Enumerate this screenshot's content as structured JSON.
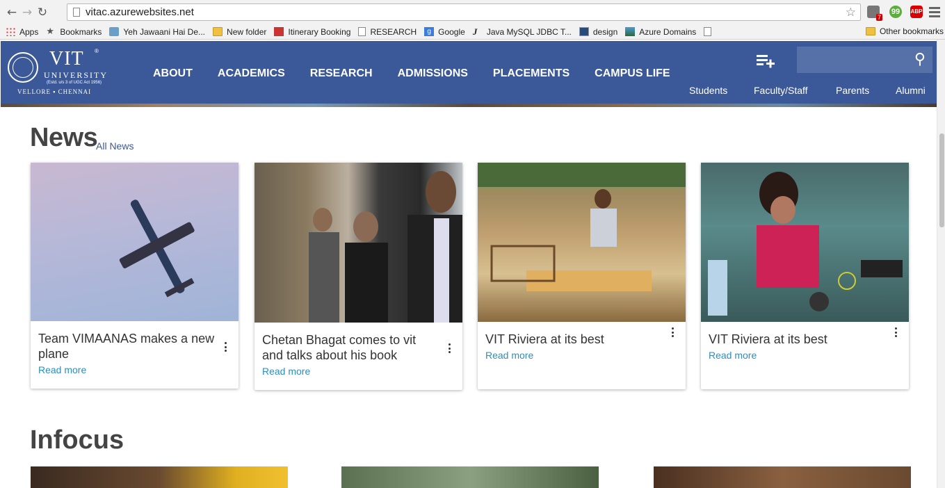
{
  "browser": {
    "url": "vitac.azurewebsites.net",
    "ext_badge": "7",
    "ext_abp": "ABP",
    "ext_green": "99"
  },
  "bookmarks": {
    "items": [
      {
        "label": "Apps",
        "icon": "apps-grid-icon"
      },
      {
        "label": "Bookmarks",
        "icon": "star-icon"
      },
      {
        "label": "Yeh Jawaani Hai De...",
        "icon": "page-icon"
      },
      {
        "label": "New folder",
        "icon": "folder-icon"
      },
      {
        "label": "Itinerary Booking",
        "icon": "page-icon"
      },
      {
        "label": "RESEARCH",
        "icon": "document-icon"
      },
      {
        "label": "Google",
        "icon": "google-icon"
      },
      {
        "label": "Java MySQL JDBC T...",
        "icon": "page-icon"
      },
      {
        "label": "design",
        "icon": "page-icon"
      },
      {
        "label": "Azure Domains",
        "icon": "page-icon"
      }
    ],
    "other": "Other bookmarks"
  },
  "site": {
    "logo": {
      "vit": "VIT",
      "reg": "®",
      "university": "UNIVERSITY",
      "estd": "(Estd. u/s 3 of UGC Act 1956)",
      "city": "VELLORE  ▪  CHENNAI"
    },
    "nav": [
      "ABOUT",
      "ACADEMICS",
      "RESEARCH",
      "ADMISSIONS",
      "PLACEMENTS",
      "CAMPUS LIFE"
    ],
    "user_nav": [
      "Students",
      "Faculty/Staff",
      "Parents",
      "Alumni"
    ],
    "search_placeholder": ""
  },
  "news": {
    "title": "News",
    "all_link": "All News",
    "cards": [
      {
        "title": "Team VIMAANAS makes a new plane",
        "more": "Read more",
        "image": "plane-photo"
      },
      {
        "title": "Chetan Bhagat comes to vit and talks about his book",
        "more": "Read more",
        "image": "event-photo"
      },
      {
        "title": "VIT Riviera at its best",
        "more": "Read more",
        "image": "campus-photo"
      },
      {
        "title": "VIT Riviera at its best",
        "more": "Read more",
        "image": "workshop-photo"
      }
    ]
  },
  "infocus": {
    "title": "Infocus"
  }
}
